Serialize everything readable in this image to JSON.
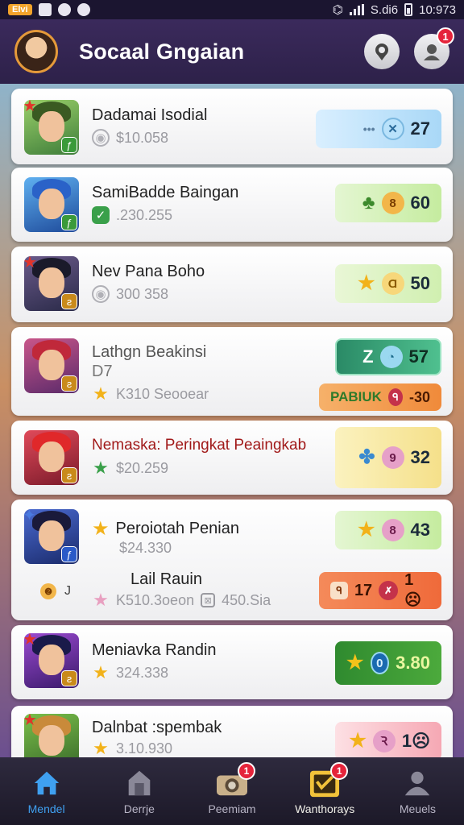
{
  "status_bar": {
    "left_badge": "Elvi",
    "carrier": "S.di6",
    "time": "10:973"
  },
  "header": {
    "title": "Socaal Gngaian",
    "notification_count": "1"
  },
  "cards": [
    {
      "name": "Dadamai Isodial",
      "sub_value": "$10.058",
      "pill_value": "27",
      "pill_color": "#d5ecfb"
    },
    {
      "name": "SamiBadde Baingan",
      "sub_value": ".230.255",
      "pill_coin": "8",
      "pill_value": "60",
      "pill_color": "#d6f0c0"
    },
    {
      "name": "Nev Pana Boho",
      "sub_value": "300 358",
      "pill_coin": "Ɑ",
      "pill_value": "50",
      "pill_color": "#ddf3c6"
    },
    {
      "name": "Lathgn Beakinsi",
      "name_line2": "D7",
      "sub_value": "K310 Seooear",
      "pill_value": "57",
      "pill_prefix": "Z",
      "pill_color": "#2f9b72",
      "secondary_label": "PABIUK",
      "secondary_value": "-30"
    },
    {
      "name": "Nemaska: Peringkat Peaingkab",
      "sub_value": "$20.259",
      "pill_coin": "9",
      "pill_value": "32",
      "pill_color": "#f8ecac"
    },
    {
      "name": "Peroiotah Penian",
      "sub_value": "$24.330",
      "extra_name": "Lail Rauin",
      "extra_sub_a": "K510.3oeon",
      "extra_sub_b": "450.Sia",
      "pill_coin": "8",
      "pill_value": "43",
      "pill_color": "#d6f0c0",
      "secondary_value_a": "17",
      "secondary_value_b": "1☹",
      "small_coin_label": "J"
    },
    {
      "name": "Meniavka Randin",
      "sub_value": "324.338",
      "pill_coin": "0",
      "pill_value": "3.80",
      "pill_color": "#3a9a3a"
    },
    {
      "name": "Dalnbat :spembak",
      "sub_value": "3.10.930",
      "pill_coin": "Ꝛ",
      "pill_value": "1☹",
      "pill_color": "#fbd0d6"
    }
  ],
  "bottom_nav": {
    "items": [
      {
        "label": "Mendel"
      },
      {
        "label": "Derrje"
      },
      {
        "label": "Peemiam",
        "badge": "1"
      },
      {
        "label": "Wanthorays",
        "badge": "1"
      },
      {
        "label": "Meuels"
      }
    ]
  }
}
